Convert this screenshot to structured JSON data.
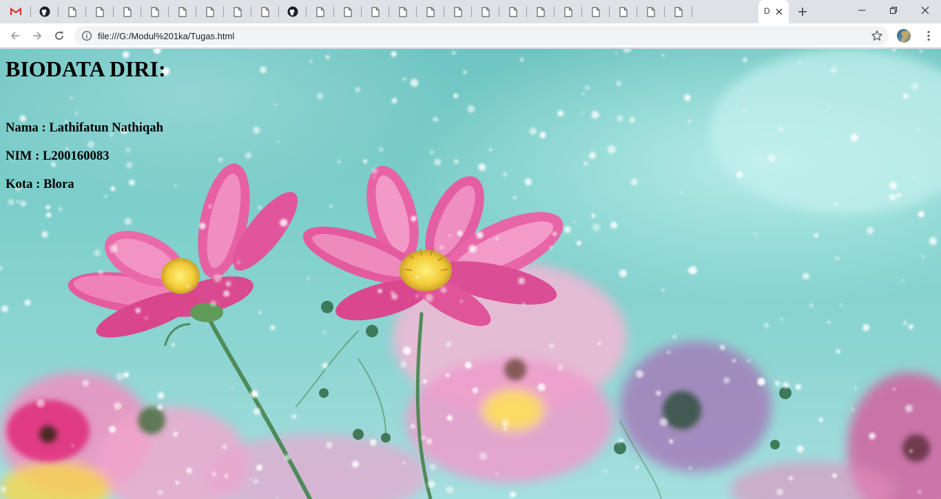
{
  "tabs": {
    "active_label": "D"
  },
  "address_bar": {
    "url": "file:///G:/Modul%201ka/Tugas.html"
  },
  "page": {
    "heading": "BIODATA DIRI:",
    "fields": [
      {
        "text": "Nama : Lathifatun Nathiqah"
      },
      {
        "text": "NIM : L200160083"
      },
      {
        "text": "Kota : Blora"
      }
    ]
  },
  "colors": {
    "gmail_red": "#d93025",
    "tabstrip_bg": "#dee1e6",
    "omnibox_bg": "#f1f3f4",
    "page_bg_teal": "#7fd0cc",
    "petal_pink": "#e8559a"
  },
  "icons": {
    "tab_favicons": [
      "gmail-icon",
      "github-icon",
      "page-icon",
      "page-icon",
      "page-icon",
      "page-icon",
      "page-icon",
      "page-icon",
      "page-icon",
      "page-icon",
      "github-icon",
      "page-icon",
      "page-icon",
      "page-icon",
      "page-icon",
      "page-icon",
      "page-icon",
      "page-icon",
      "page-icon",
      "page-icon",
      "page-icon",
      "page-icon",
      "page-icon",
      "page-icon",
      "page-icon"
    ],
    "toolbar": [
      "back-arrow-icon",
      "forward-arrow-icon",
      "reload-icon",
      "info-icon",
      "star-icon",
      "avatar",
      "menu-dots-icon"
    ]
  }
}
